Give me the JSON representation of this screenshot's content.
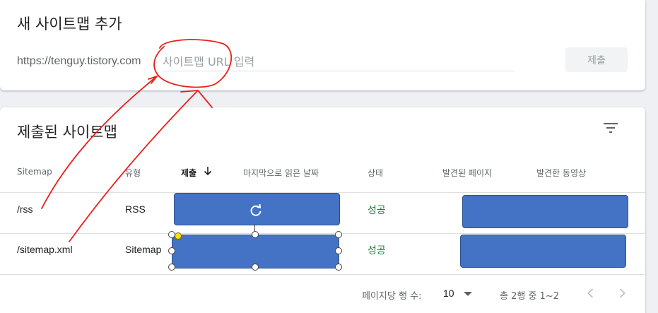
{
  "add_card": {
    "title": "새 사이트맵 추가",
    "url_prefix": "https://tenguy.tistory.com",
    "input_placeholder": "사이트맵 URL 입력",
    "input_value": "",
    "submit_label": "제출"
  },
  "list_card": {
    "title": "제출된 사이트맵",
    "filter_icon": "filter-icon",
    "columns": [
      "Sitemap",
      "유형",
      "제출",
      "마지막으로 읽은 날짜",
      "상태",
      "발견된 페이지",
      "발견한 동영상"
    ],
    "sort_icon": "arrow-down-icon",
    "rows": [
      {
        "sitemap": "/rss",
        "type": "RSS",
        "status": "성공"
      },
      {
        "sitemap": "/sitemap.xml",
        "type": "Sitemap",
        "status": "성공"
      }
    ],
    "footer": {
      "rows_per_page_label": "페이지당 행 수:",
      "rows_per_page_value": "10",
      "range_text": "총 2행 중 1~2"
    }
  },
  "colors": {
    "overlay_box": "#4472c4",
    "annotation": "#e8201a",
    "status_ok": "#188038"
  }
}
